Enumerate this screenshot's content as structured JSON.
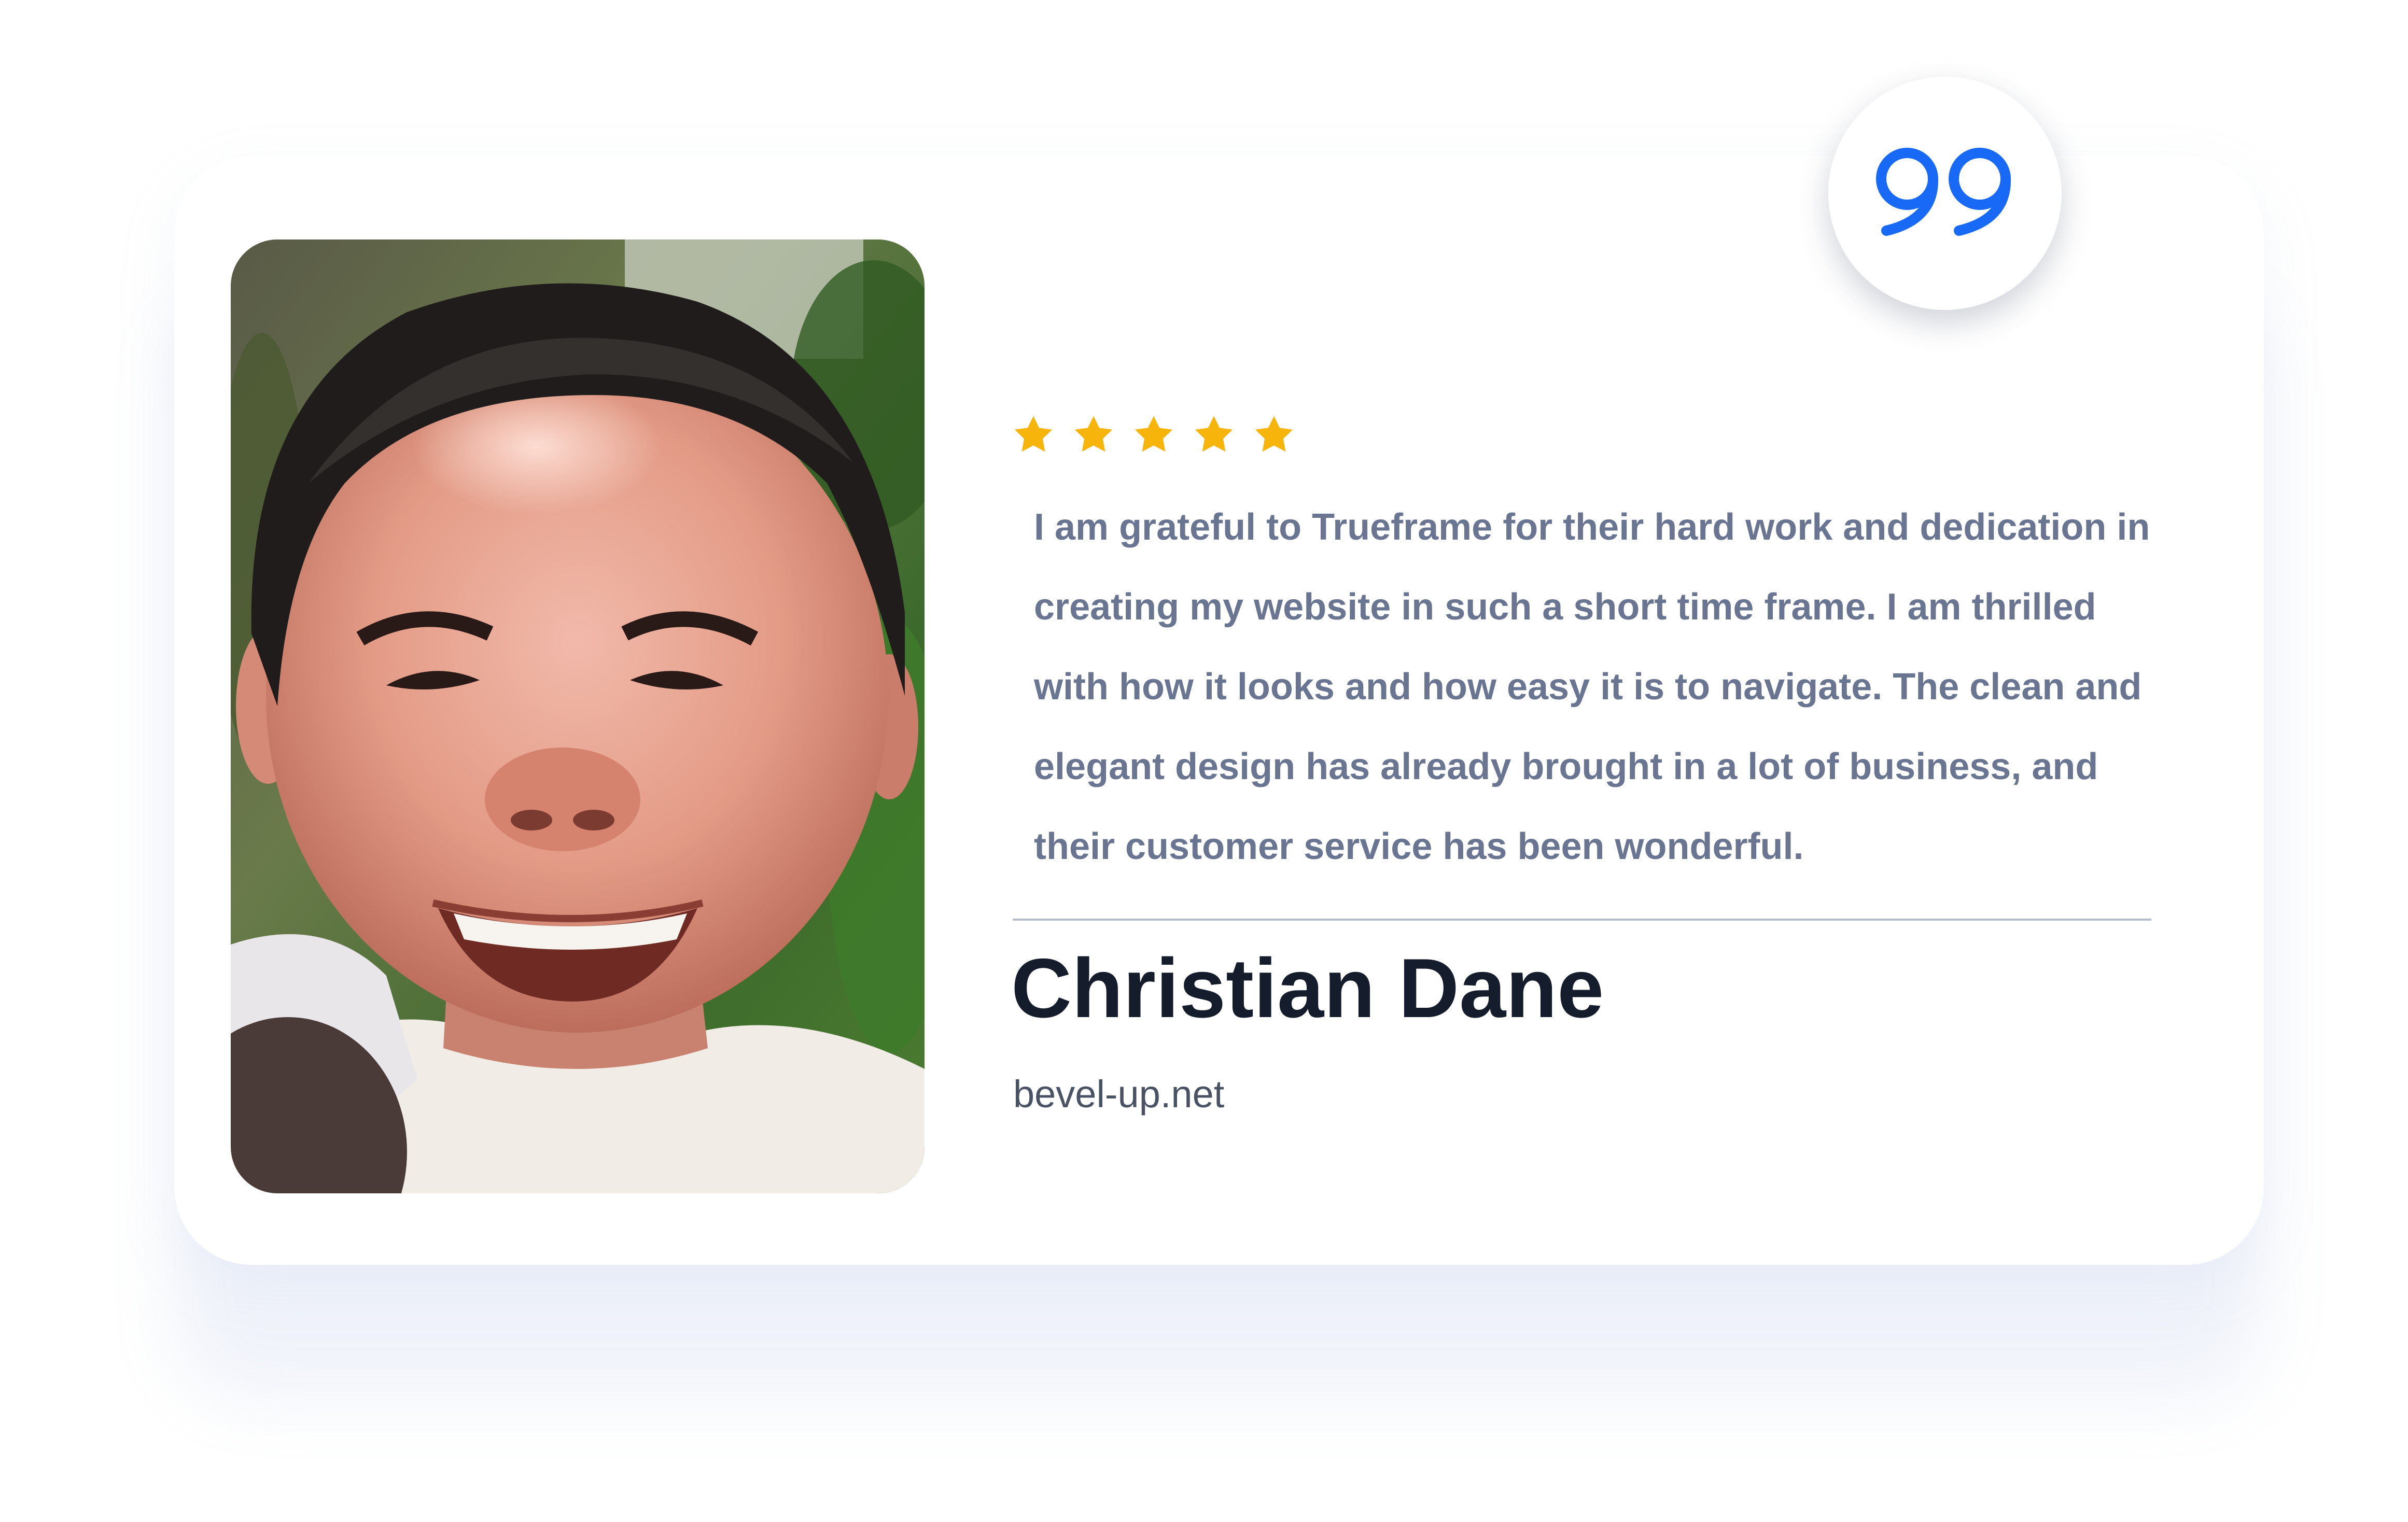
{
  "testimonial": {
    "rating": 5,
    "rating_max": 5,
    "review_lines": [
      "I am grateful to Trueframe for their hard work and dedication in",
      "creating my website in such a short time frame. I am thrilled",
      "with how it looks and how easy it is to navigate. The clean and",
      "elegant design has already brought in a lot of business, and",
      "their customer service has been wonderful."
    ],
    "author_name": "Christian Dane",
    "author_company": "bevel-up.net"
  },
  "icons": {
    "quote": "quote-icon",
    "star": "star-icon",
    "photo": "author-photo"
  },
  "colors": {
    "accent_blue": "#1769f6",
    "star_gold": "#f7b40a",
    "review_text": "#6a7591",
    "name_text": "#151c2b",
    "company_text": "#4a5366",
    "divider": "#b4bbcb",
    "card_background": "#ffffff"
  }
}
